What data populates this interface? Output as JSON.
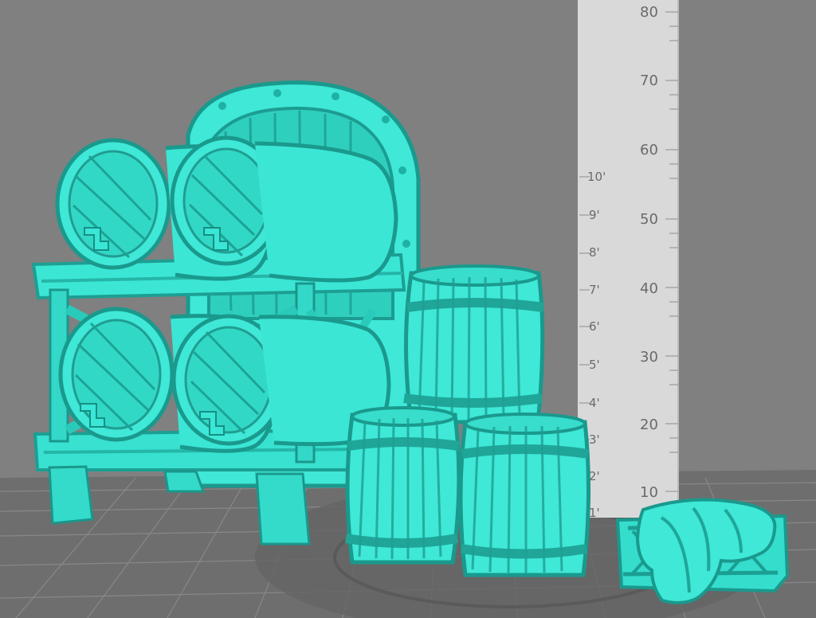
{
  "scene": {
    "colors": {
      "background": "#808080",
      "floor": "#6f6f6f",
      "floor_grid": "#9a9a9a",
      "model": "#3fe8d7",
      "model_shadow": "#22b8a8",
      "model_dark": "#17877c",
      "ruler": "#d9d9d9",
      "ruler_text": "#6a6a6a"
    },
    "ruler": {
      "metric_labels": [
        "80",
        "70",
        "60",
        "50",
        "40",
        "30",
        "20",
        "10"
      ],
      "imperial_labels": [
        "10'",
        "9'",
        "8'",
        "7'",
        "6'",
        "5'",
        "4'",
        "3'",
        "2'",
        "1'"
      ]
    },
    "objects": [
      {
        "name": "barrel-rack"
      },
      {
        "name": "arched-door"
      },
      {
        "name": "stacked-barrels"
      },
      {
        "name": "covered-crate"
      }
    ]
  }
}
